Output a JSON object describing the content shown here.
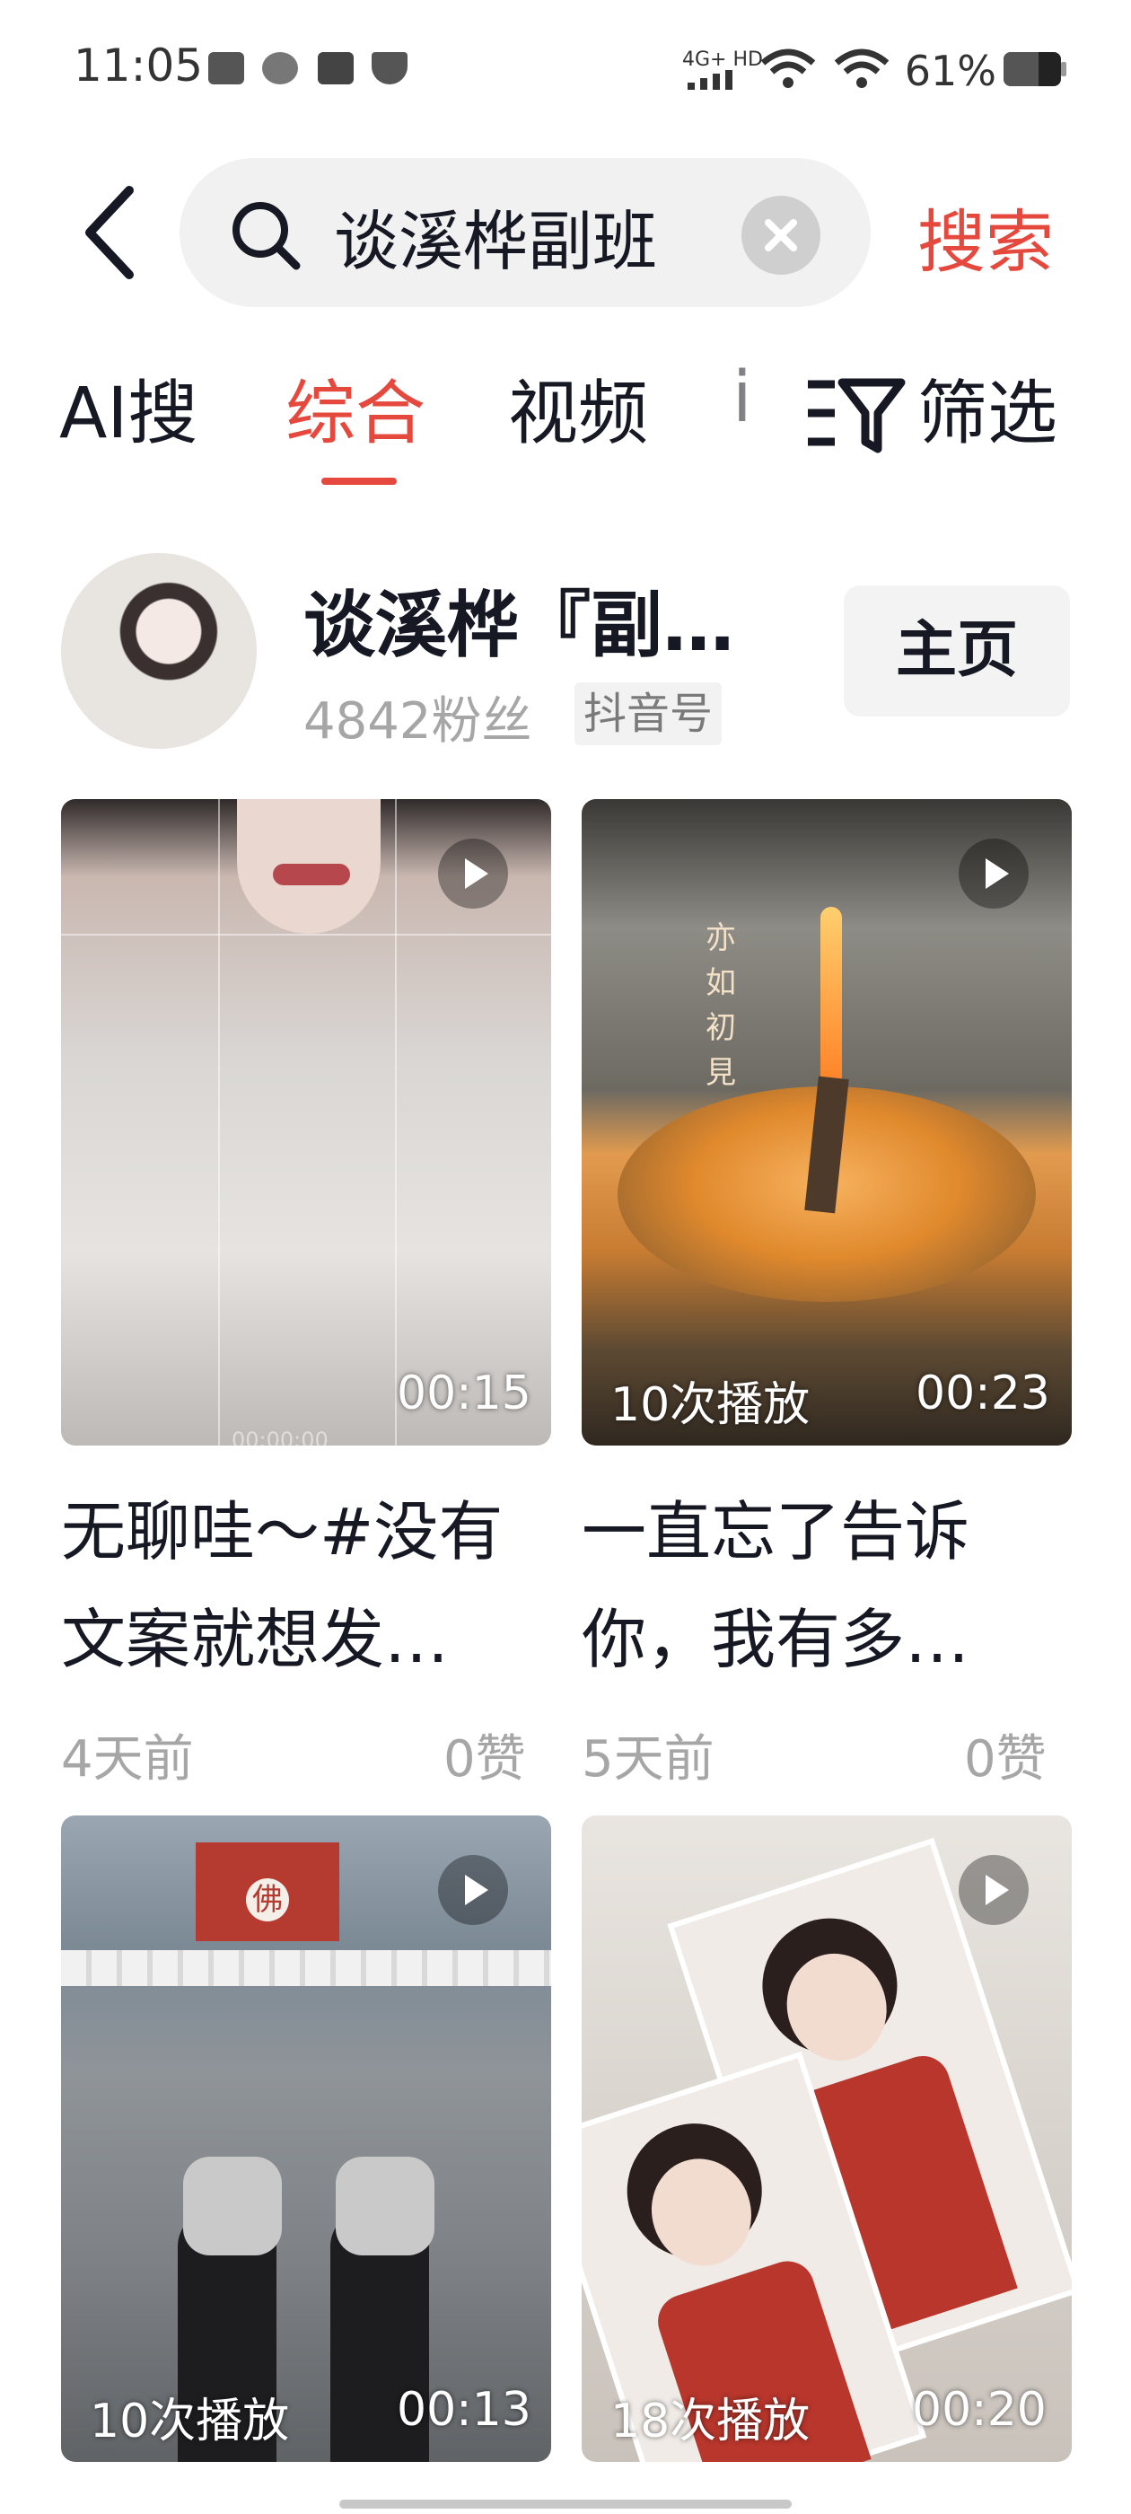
{
  "status_bar": {
    "time": "11:05",
    "battery_percent_text": "61%",
    "battery_level": 0.61,
    "network": "4G+ HD"
  },
  "search": {
    "query": "谈溪桦副班",
    "button_label": "搜索"
  },
  "tabs": [
    {
      "label": "AI搜"
    },
    {
      "label": "综合",
      "active": true
    },
    {
      "label": "视频"
    },
    {
      "label": "i"
    }
  ],
  "filter_label": "筛选",
  "user": {
    "name": "谈溪桦『副…",
    "fans": "4842粉丝",
    "tag": "抖音号",
    "home_button": "主页"
  },
  "videos": [
    {
      "plays": "",
      "duration": "00:15",
      "caption_line1": "无聊哇～#没有",
      "caption_line2": "文案就想发…",
      "time_ago": "4天前",
      "likes": "0赞",
      "overlay_text": "",
      "watermark": "00:00:00"
    },
    {
      "plays": "10次播放",
      "duration": "00:23",
      "caption_line1": "一直忘了告诉",
      "caption_line2": "你，我有多…",
      "time_ago": "5天前",
      "likes": "0赞",
      "overlay_text": "亦如初見"
    },
    {
      "plays": "10次播放",
      "duration": "00:13",
      "sign_text": "佛"
    },
    {
      "plays": "18次播放",
      "duration": "00:20"
    }
  ],
  "colors": {
    "accent": "#e5483c",
    "text": "#161823",
    "muted": "#a6a6a6"
  }
}
